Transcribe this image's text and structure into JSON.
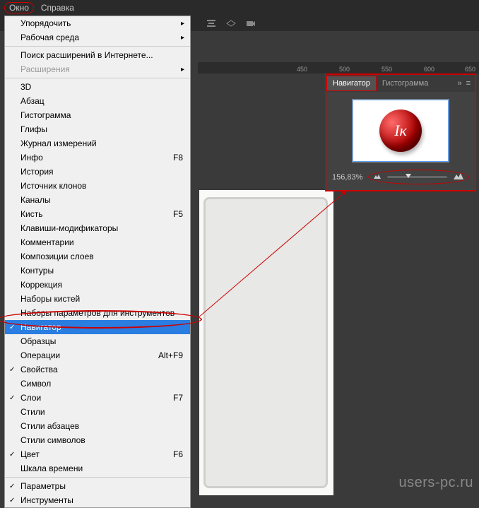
{
  "menubar": {
    "window": "Окно",
    "help": "Справка"
  },
  "menu": {
    "arrange": "Упорядочить",
    "workspace": "Рабочая среда",
    "browse_ext": "Поиск расширений в Интернете...",
    "extensions": "Расширения",
    "three_d": "3D",
    "paragraph": "Абзац",
    "histogram": "Гистограмма",
    "glyphs": "Глифы",
    "measure_log": "Журнал измерений",
    "info": "Инфо",
    "info_sc": "F8",
    "history": "История",
    "clone_source": "Источник клонов",
    "channels": "Каналы",
    "brush": "Кисть",
    "brush_sc": "F5",
    "modifier_keys": "Клавиши-модификаторы",
    "notes": "Комментарии",
    "layer_comps": "Композиции слоев",
    "paths": "Контуры",
    "adjustments": "Коррекция",
    "brush_presets": "Наборы кистей",
    "tool_presets": "Наборы параметров для инструментов",
    "navigator": "Навигатор",
    "swatches": "Образцы",
    "actions": "Операции",
    "actions_sc": "Alt+F9",
    "properties": "Свойства",
    "character": "Символ",
    "layers": "Слои",
    "layers_sc": "F7",
    "styles": "Стили",
    "para_styles": "Стили абзацев",
    "char_styles": "Стили символов",
    "color": "Цвет",
    "color_sc": "F6",
    "timeline": "Шкала времени",
    "options": "Параметры",
    "tools": "Инструменты"
  },
  "ruler": {
    "t450": "450",
    "t500": "500",
    "t550": "550",
    "t600": "600",
    "t650": "650"
  },
  "nav": {
    "tab_navigator": "Навигатор",
    "tab_histogram": "Гистограмма",
    "zoom": "156,83%",
    "sphere_letter": "Iк"
  },
  "watermark": "users-pc.ru"
}
